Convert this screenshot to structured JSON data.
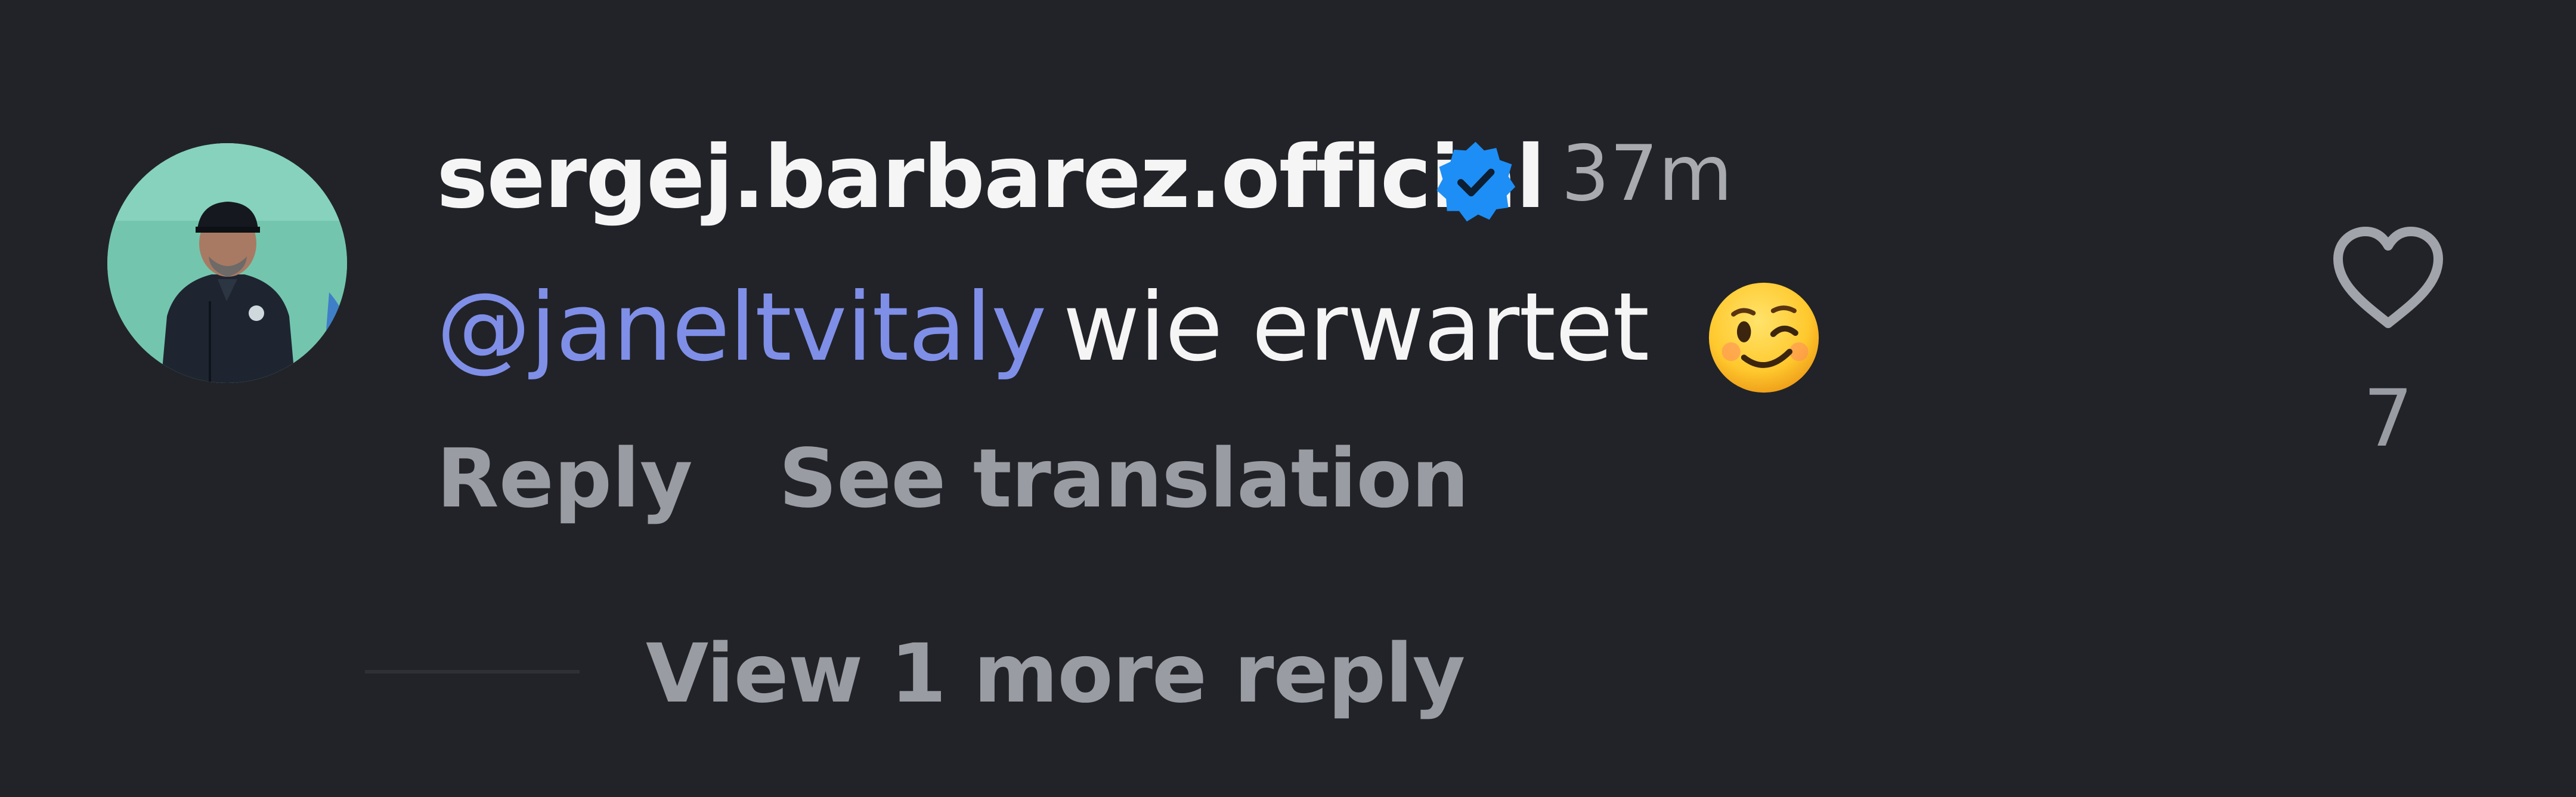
{
  "comment": {
    "username": "sergej.barbarez.official",
    "timestamp": "37m",
    "mention": "@janeltvitaly",
    "text": "wie erwartet",
    "emoji_name": "winking-face-emoji",
    "verified_icon": "verified-badge-icon",
    "like_icon": "heart-outline-icon",
    "like_count": "7"
  },
  "actions": {
    "reply_label": "Reply",
    "translate_label": "See translation",
    "view_replies_label": "View 1 more reply"
  },
  "colors": {
    "background": "#222328",
    "mention": "#7f8fe8",
    "verified": "#1d8ef5",
    "muted_text": "#9a9ca3"
  }
}
